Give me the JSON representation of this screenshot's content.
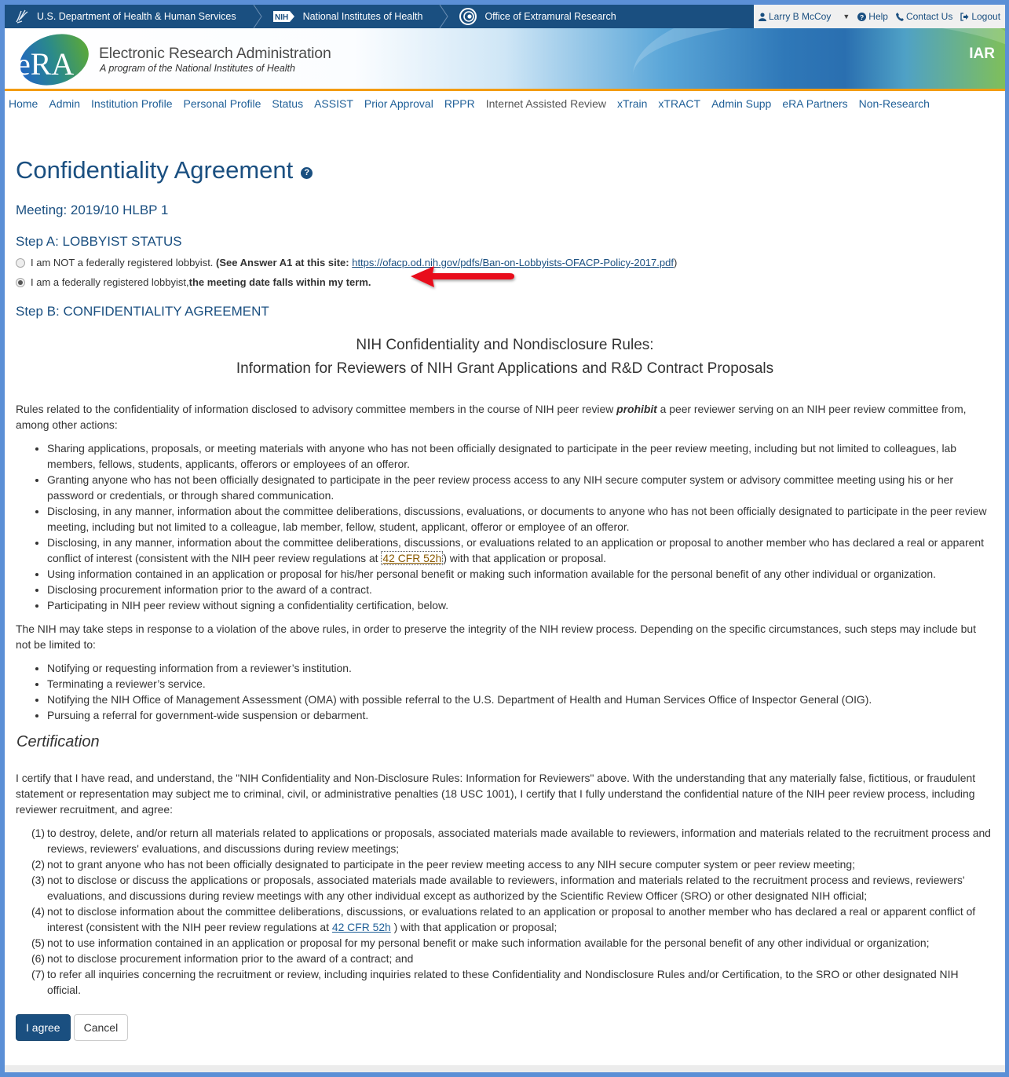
{
  "topbar": {
    "crumbs": [
      {
        "label": "U.S. Department of Health & Human Services",
        "icon": "hhs-eagle-icon"
      },
      {
        "label": "National Institutes of Health",
        "icon": "nih-logo-icon",
        "badge": "NIH"
      },
      {
        "label": "Office of Extramural Research",
        "icon": "oer-logo-icon"
      }
    ],
    "user_name": "Larry B McCoy",
    "help_label": "Help",
    "contact_label": "Contact Us",
    "logout_label": "Logout"
  },
  "banner": {
    "logo_text": "eRA",
    "title": "Electronic Research Administration",
    "subtitle": "A program of the National Institutes of Health",
    "module": "IAR"
  },
  "nav": {
    "items": [
      {
        "label": "Home"
      },
      {
        "label": "Admin"
      },
      {
        "label": "Institution Profile"
      },
      {
        "label": "Personal Profile"
      },
      {
        "label": "Status"
      },
      {
        "label": "ASSIST"
      },
      {
        "label": "Prior Approval"
      },
      {
        "label": "RPPR"
      },
      {
        "label": "Internet Assisted Review",
        "active": true
      },
      {
        "label": "xTrain"
      },
      {
        "label": "xTRACT"
      },
      {
        "label": "Admin Supp"
      },
      {
        "label": "eRA Partners"
      },
      {
        "label": "Non-Research"
      }
    ]
  },
  "page": {
    "title": "Confidentiality Agreement",
    "meeting": "Meeting: 2019/10 HLBP 1",
    "step_a": "Step A: LOBBYIST STATUS",
    "radio_not_lobbyist": {
      "text": "I am NOT a federally registered lobbyist.",
      "bold": "(See Answer A1 at this site:",
      "link": "https://ofacp.od.nih.gov/pdfs/Ban-on-Lobbyists-OFACP-Policy-2017.pdf",
      "after": ")",
      "checked": false
    },
    "radio_lobbyist": {
      "text": "I am a federally registered lobbyist,",
      "bold": "the meeting date falls within my term.",
      "checked": true
    },
    "step_b": "Step B: CONFIDENTIALITY AGREEMENT",
    "rules_title_1": "NIH Confidentiality and Nondisclosure Rules:",
    "rules_title_2": "Information for Reviewers of NIH Grant Applications and R&D Contract Proposals",
    "intro_before": "Rules related to the confidentiality of information disclosed to advisory committee members in the course of NIH peer review ",
    "intro_em": "prohibit",
    "intro_after": " a peer reviewer serving on an NIH peer review committee from, among other actions:",
    "prohibitions": [
      "Sharing applications, proposals, or meeting materials with anyone who has not been officially designated to participate in the peer review meeting, including but not limited to colleagues, lab members, fellows, students, applicants, offerors or employees of an offeror.",
      "Granting anyone who has not been officially designated to participate in the peer review process access to any NIH secure computer system or advisory committee meeting using his or her password or credentials, or through shared communication.",
      "Disclosing, in any manner, information about the committee deliberations, discussions, evaluations, or documents to anyone who has not been officially designated to participate in the peer review meeting, including but not limited to a colleague, lab member, fellow, student, applicant, offeror or employee of an offeror.",
      "Using information contained in an application or proposal for his/her personal benefit or making such information available for the personal benefit of any other individual or organization.",
      "Disclosing procurement information prior to the award of a contract.",
      "Participating in NIH peer review without signing a confidentiality certification, below."
    ],
    "prohibition_coi": {
      "before": "Disclosing, in any manner, information about the committee deliberations, discussions, or evaluations related to an application or proposal to another member who has declared a real or apparent conflict of interest (consistent with the NIH peer review regulations at ",
      "link": "42 CFR 52h",
      "after": ") with that application or proposal."
    },
    "steps_intro": "The NIH may take steps in response to a violation of the above rules, in order to preserve the integrity of the NIH review process. Depending on the specific circumstances, such steps may include but not be limited to:",
    "steps": [
      "Notifying or requesting information from a reviewer’s institution.",
      "Terminating a reviewer’s service.",
      "Notifying the NIH Office of Management Assessment (OMA) with possible referral to the U.S. Department of Health and Human Services Office of Inspector General (OIG).",
      "Pursuing a referral for government-wide suspension or debarment."
    ],
    "cert_heading": "Certification",
    "cert_intro": "I certify that I have read, and understand, the \"NIH Confidentiality and Non-Disclosure Rules: Information for Reviewers\" above. With the understanding that any materially false, fictitious, or fraudulent statement or representation may subject me to criminal, civil, or administrative penalties (18 USC 1001), I certify that I fully understand the confidential nature of the NIH peer review process, including reviewer recruitment, and agree:",
    "cert_items": [
      {
        "num": "(1)",
        "text": "to destroy, delete, and/or return all materials related to applications or proposals, associated materials made available to reviewers, information and materials related to the recruitment process and reviews, reviewers' evaluations, and discussions during review meetings;"
      },
      {
        "num": "(2)",
        "text": "not to grant anyone who has not been officially designated to participate in the peer review meeting access to any NIH secure computer system or peer review meeting;"
      },
      {
        "num": "(3)",
        "text": "not to disclose or discuss the applications or proposals, associated materials made available to reviewers, information and materials related to the recruitment process and reviews, reviewers' evaluations, and discussions during review meetings with any other individual except as authorized by the Scientific Review Officer (SRO) or other designated NIH official;"
      },
      {
        "num": "(4)",
        "before": "not to disclose information about the committee deliberations, discussions, or evaluations related to an application or proposal to another member who has declared a real or apparent conflict of interest (consistent with the NIH peer review regulations at ",
        "link": "42 CFR 52h",
        "after": " ) with that application or proposal;"
      },
      {
        "num": "(5)",
        "text": "not to use information contained in an application or proposal for my personal benefit or make such information available for the personal benefit of any other individual or organization;"
      },
      {
        "num": "(6)",
        "text": "not to disclose procurement information prior to the award of a contract; and"
      },
      {
        "num": "(7)",
        "text": "to refer all inquiries concerning the recruitment or review, including inquiries related to these Confidentiality and Nondisclosure Rules and/or Certification, to the SRO or other designated NIH official."
      }
    ],
    "agree_label": "I agree",
    "cancel_label": "Cancel"
  },
  "colors": {
    "primary": "#1a4f80",
    "accent_orange": "#f39c12",
    "annotation_arrow": "#e8111a"
  }
}
